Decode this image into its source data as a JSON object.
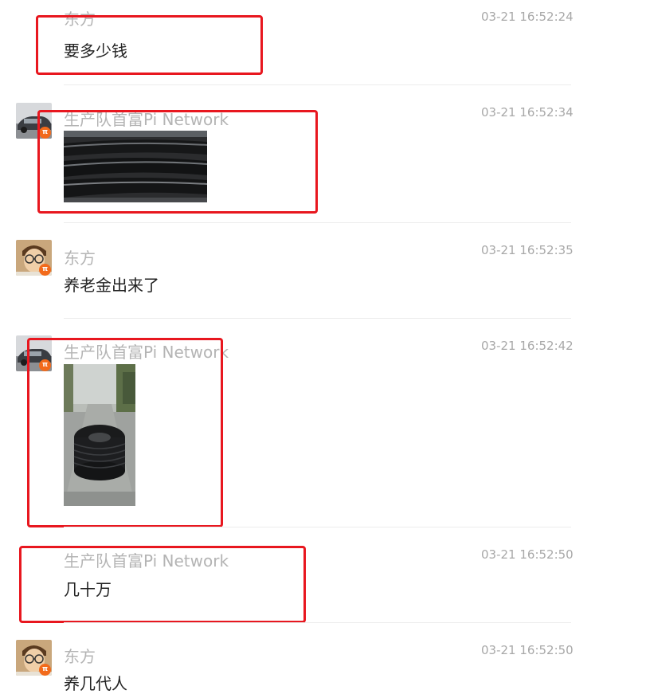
{
  "messages": [
    {
      "sender": "东方",
      "time": "03-21 16:52:24",
      "text": "要多少钱"
    },
    {
      "sender": "生产队首富Pi Network",
      "time": "03-21 16:52:34",
      "image": "coiled-pipe-closeup"
    },
    {
      "sender": "东方",
      "time": "03-21 16:52:35",
      "text": "养老金出来了"
    },
    {
      "sender": "生产队首富Pi Network",
      "time": "03-21 16:52:42",
      "image": "pipe-roll-on-road"
    },
    {
      "sender": "生产队首富Pi Network",
      "time": "03-21 16:52:50",
      "text": "几十万"
    },
    {
      "sender": "东方",
      "time": "03-21 16:52:50",
      "text": "养几代人"
    }
  ],
  "badge_glyph": "π",
  "colors": {
    "highlight": "#e8171f",
    "badge": "#f26a1b",
    "name": "#b4b4b4",
    "time": "#a8a8a8",
    "text": "#222222"
  }
}
